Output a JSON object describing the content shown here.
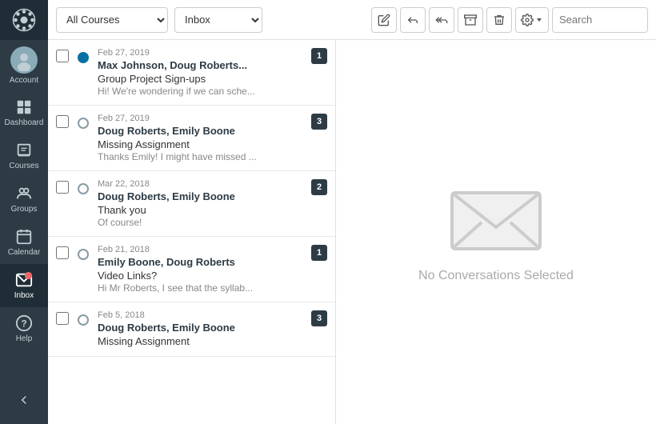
{
  "sidebar": {
    "logo_alt": "Canvas Logo",
    "items": [
      {
        "id": "account",
        "label": "Account",
        "active": false,
        "has_avatar": true
      },
      {
        "id": "dashboard",
        "label": "Dashboard",
        "active": false
      },
      {
        "id": "courses",
        "label": "Courses",
        "active": false
      },
      {
        "id": "groups",
        "label": "Groups",
        "active": false
      },
      {
        "id": "calendar",
        "label": "Calendar",
        "active": false
      },
      {
        "id": "inbox",
        "label": "Inbox",
        "active": true
      },
      {
        "id": "help",
        "label": "Help",
        "active": false
      }
    ],
    "collapse_label": "Collapse"
  },
  "toolbar": {
    "courses_select_value": "All Courses",
    "inbox_select_value": "Inbox",
    "compose_label": "Compose",
    "reply_label": "Reply",
    "reply_all_label": "Reply All",
    "archive_label": "Archive",
    "delete_label": "Delete",
    "settings_label": "Settings",
    "search_placeholder": "Search"
  },
  "messages": [
    {
      "date": "Feb 27, 2019",
      "sender": "Max Johnson, Doug Roberts...",
      "subject": "Group Project Sign-ups",
      "preview": "Hi! We're wondering if we can sche...",
      "badge": "1",
      "unread": true
    },
    {
      "date": "Feb 27, 2019",
      "sender": "Doug Roberts, Emily Boone",
      "subject": "Missing Assignment",
      "preview": "Thanks Emily! I might have missed ...",
      "badge": "3",
      "unread": false
    },
    {
      "date": "Mar 22, 2018",
      "sender": "Doug Roberts, Emily Boone",
      "subject": "Thank you",
      "preview": "Of course!",
      "badge": "2",
      "unread": false
    },
    {
      "date": "Feb 21, 2018",
      "sender": "Emily Boone, Doug Roberts",
      "subject": "Video Links?",
      "preview": "Hi Mr Roberts, I see that the syllab...",
      "badge": "1",
      "unread": false
    },
    {
      "date": "Feb 5, 2018",
      "sender": "Doug Roberts, Emily Boone",
      "subject": "Missing Assignment",
      "preview": "",
      "badge": "3",
      "unread": false
    }
  ],
  "empty_state": {
    "text": "No Conversations Selected"
  }
}
